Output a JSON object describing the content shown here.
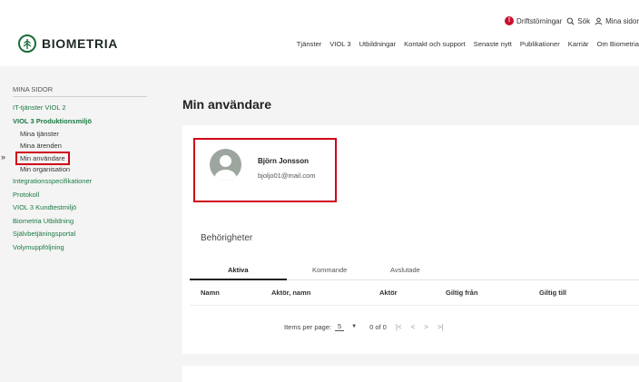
{
  "utility": {
    "alert_count": "!",
    "disturbances_label": "Driftstörningar",
    "search_label": "Sök",
    "my_pages_label": "Mina sidor"
  },
  "logo": {
    "text": "BIOMETRIA"
  },
  "nav": [
    "Tjänster",
    "VIOL 3",
    "Utbildningar",
    "Kontakt och support",
    "Senaste nytt",
    "Publikationer",
    "Karriär",
    "Om Biometria"
  ],
  "sidebar": {
    "heading": "MINA SIDOR",
    "items": [
      {
        "label": "IT-tjänster VIOL 2",
        "level": 1
      },
      {
        "label": "VIOL 3 Produktionsmiljö",
        "level": 1,
        "bold": true
      },
      {
        "label": "Mina tjänster",
        "level": 2
      },
      {
        "label": "Mina ärenden",
        "level": 2
      },
      {
        "label": "Min användare",
        "level": 2,
        "current": true
      },
      {
        "label": "Min organisation",
        "level": 2
      },
      {
        "label": "Integrationsspecifikationer",
        "level": 1
      },
      {
        "label": "Protokoll",
        "level": 1
      },
      {
        "label": "VIOL 3 Kundtestmiljö",
        "level": 1
      },
      {
        "label": "Biometria Utbildning",
        "level": 1
      },
      {
        "label": "Självbetjäningsportal",
        "level": 1
      },
      {
        "label": "Volymuppföljning",
        "level": 1
      }
    ]
  },
  "page": {
    "title": "Min användare"
  },
  "profile": {
    "name": "Björn Jonsson",
    "email": "bjoljo01@mail.com"
  },
  "permissions": {
    "title": "Behörigheter",
    "tabs": [
      "Aktiva",
      "Kommande",
      "Avslutade"
    ],
    "active_tab": "Aktiva",
    "columns": [
      "Namn",
      "Aktör, namn",
      "Aktör",
      "Giltig från",
      "Giltig till"
    ]
  },
  "pager": {
    "items_per_page_label": "Items per page:",
    "items_per_page_value": "5",
    "range": "0 of 0",
    "first_icon": "|<",
    "prev_icon": "<",
    "next_icon": ">",
    "last_icon": ">|"
  },
  "colors": {
    "brand_green": "#1a7a43",
    "highlight_red": "#d0021b",
    "alert_red": "#c8102e",
    "content_bg": "#f4f4f4"
  }
}
